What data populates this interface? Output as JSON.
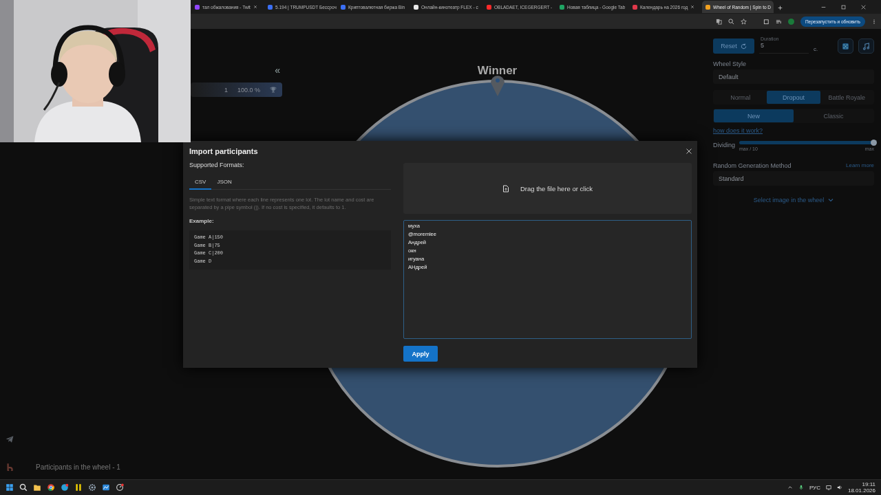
{
  "browser": {
    "tabs": [
      {
        "label": "тал обжалования - Twit",
        "color": "#9146ff",
        "selected": false
      },
      {
        "label": "5.194 | TRUMPUSDT Бессроч",
        "color": "#3b6ff5",
        "selected": false
      },
      {
        "label": "Криптовалютная биржа Bin",
        "color": "#3b6ff5",
        "selected": false
      },
      {
        "label": "Онлайн-кинотеатр FLEX - с",
        "color": "#e8e8e8",
        "selected": false
      },
      {
        "label": "OBLADAET, ICEGERGERT -",
        "color": "#ff2a2a",
        "selected": false
      },
      {
        "label": "Новая таблица - Google Tab",
        "color": "#1fa463",
        "selected": false
      },
      {
        "label": "Календарь на 2026 год",
        "color": "#e0384a",
        "selected": false
      },
      {
        "label": "Wheel of Random | Spin to D",
        "color": "#f0a020",
        "selected": true
      }
    ],
    "relaunch_button": "Перезапустить и обновить"
  },
  "sidebar": {
    "collapse": "«",
    "participant": {
      "count": "1",
      "share": "100.0 %"
    },
    "footer": "Participants in the wheel - 1"
  },
  "wheel": {
    "title": "Winner"
  },
  "settings": {
    "reset": "Reset",
    "duration": {
      "label": "Duration",
      "value": "5",
      "unit": "с."
    },
    "wheel_style": {
      "label": "Wheel Style",
      "value": "Default"
    },
    "modes": [
      {
        "label": "Normal",
        "selected": false
      },
      {
        "label": "Dropout",
        "selected": true
      },
      {
        "label": "Battle Royale",
        "selected": false
      }
    ],
    "variants": [
      {
        "label": "New",
        "selected": true
      },
      {
        "label": "Classic",
        "selected": false
      }
    ],
    "help_link": "how does it work?",
    "dividing": {
      "label": "Dividing",
      "level": 1,
      "min_label": "max / 10",
      "max_label": "max"
    },
    "random_method": {
      "label": "Random Generation Method",
      "link": "Learn more",
      "value": "Standard"
    },
    "image_select": "Select image in the wheel"
  },
  "modal": {
    "title": "Import participants",
    "formats_label": "Supported Formats:",
    "tabs": [
      {
        "label": "CSV",
        "selected": true
      },
      {
        "label": "JSON",
        "selected": false
      }
    ],
    "description": "Simple text format where each line represents one lot. The lot name and cost are separated by a pipe symbol (|). If no cost is specified, it defaults to 1.",
    "example_label": "Example:",
    "example_lines": [
      "Game A|150",
      "Game B|75",
      "Game C|200",
      "Game D"
    ],
    "dropzone": "Drag the file here or click",
    "input": {
      "value": "муха\n@moremlee\nАндрей\nокн\nигуана\nАНдрей\n"
    },
    "apply": "Apply"
  },
  "taskbar": {
    "language": "РУС",
    "time": "19:11",
    "date": "18.01.2026"
  }
}
